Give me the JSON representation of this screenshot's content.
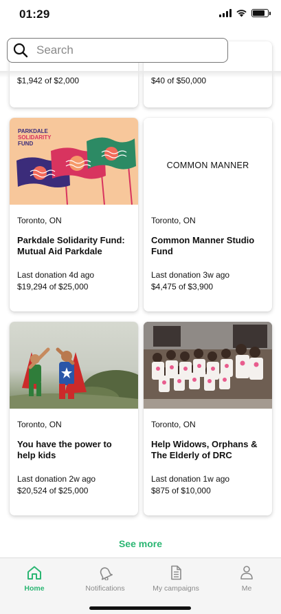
{
  "status_bar": {
    "time": "01:29",
    "battery_level": 0.8
  },
  "search": {
    "placeholder": "Search",
    "value": ""
  },
  "partial_cards": [
    {
      "amount": "$1,942 of $2,000"
    },
    {
      "amount": "$40 of $50,000"
    }
  ],
  "cards": [
    {
      "image": "parkdale-solidarity-flags",
      "image_text": [
        "PARKDALE",
        "SOLIDARITY",
        "FUND"
      ],
      "location": "Toronto, ON",
      "title": "Parkdale Solidarity Fund: Mutual Aid Parkdale",
      "last_donation": "Last donation 4d ago",
      "amount": "$19,294 of $25,000"
    },
    {
      "image": "common-manner-logo",
      "image_text": [
        "COMMON MANNER"
      ],
      "location": "Toronto, ON",
      "title": "Common Manner Studio Fund",
      "last_donation": "Last donation 3w ago",
      "amount": "$4,475 of $3,900"
    },
    {
      "image": "kids-superhero-photo",
      "location": "Toronto, ON",
      "title": "You have the power to help kids",
      "last_donation": "Last donation 2w ago",
      "amount": "$20,524 of $25,000"
    },
    {
      "image": "drc-children-group-photo",
      "location": "Toronto, ON",
      "title": "Help Widows, Orphans & The Elderly of DRC",
      "last_donation": "Last donation 1w ago",
      "amount": "$875 of $10,000"
    }
  ],
  "see_more": "See more",
  "tabs": [
    {
      "label": "Home",
      "icon": "home-icon",
      "active": true
    },
    {
      "label": "Notifications",
      "icon": "bell-icon",
      "active": false
    },
    {
      "label": "My campaigns",
      "icon": "document-icon",
      "active": false
    },
    {
      "label": "Me",
      "icon": "person-icon",
      "active": false
    }
  ],
  "colors": {
    "accent": "#2bb673",
    "inactive": "#8a8a8a",
    "flag_bg": "#f7c79b"
  }
}
